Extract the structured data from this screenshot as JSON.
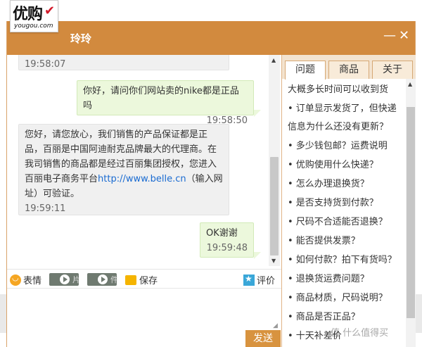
{
  "window": {
    "title": "玲玲"
  },
  "logo": {
    "main": "优购",
    "sub": "yougou.com"
  },
  "controls": {
    "minimize": "—",
    "close": "✕"
  },
  "messages": [
    {
      "side": "left",
      "text": "",
      "time": "19:58:07"
    },
    {
      "side": "right",
      "text": "你好，请问你们网站卖的nike都是正品吗",
      "time": "19:58:50"
    },
    {
      "side": "left",
      "lines": [
        "您好，请您放心，我们销售的产品保证都是正",
        "品，百丽是中国阿迪耐克品牌最大的代理商。在",
        "我司销售的商品都是经过百丽集团授权，您进入",
        "百丽电子商务平台"
      ],
      "link": "http://www.belle.cn",
      "after_link": "（输入网",
      "last_line": "址）可验证。",
      "time": "19:59:11"
    },
    {
      "side": "right",
      "text": "OK谢谢",
      "time": "19:59:48"
    }
  ],
  "toolbar": {
    "emoji_label": "表情",
    "image_suffix": "片",
    "file_suffix": "件",
    "save_label": "保存",
    "rate_label": "评价"
  },
  "send_label": "发送",
  "tabs": [
    "问题",
    "商品",
    "关于"
  ],
  "faq": [
    "大概多长时间可以收到货",
    "• 订单显示发货了，但快递",
    "信息为什么还没有更新？",
    "• 多少钱包邮？运费说明",
    "• 优购使用什么快递？",
    "• 怎么办理退换货？",
    "• 是否支持货到付款？",
    "• 尺码不合适能否退换？",
    "• 能否提供发票？",
    "• 如何付款？拍下有货吗？",
    "• 退换货运费问题？",
    "• 商品材质，尺码说明？",
    "• 商品是否正品？",
    "• 十天补差价"
  ],
  "watermark": "值 什么值得买",
  "colors": {
    "titlebar": "#d28a3e",
    "send": "#d8933f",
    "link": "#1a6bd1"
  }
}
